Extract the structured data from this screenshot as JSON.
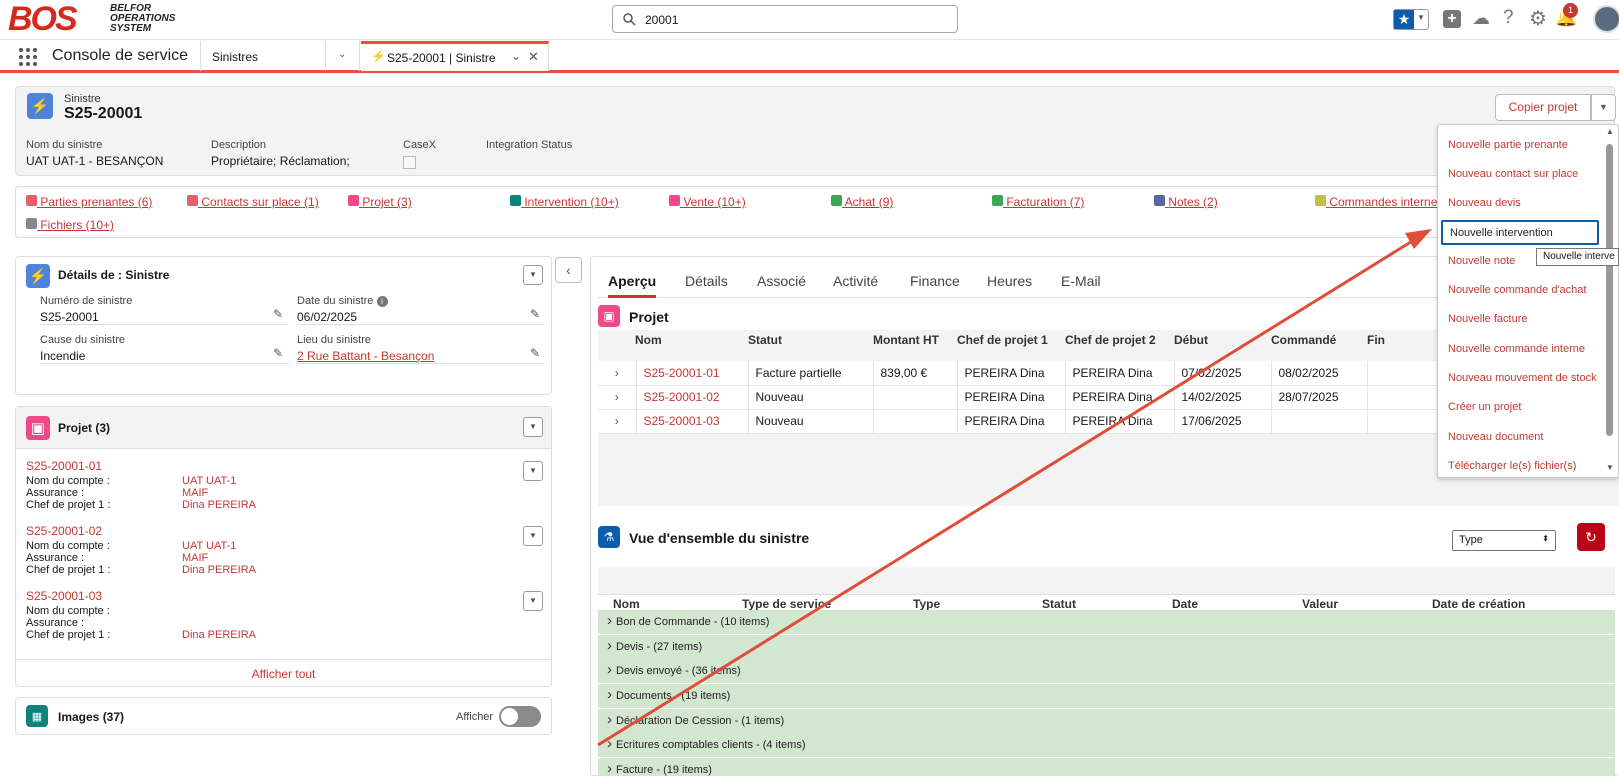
{
  "app": {
    "logo": "BOS",
    "logo_sub": [
      "BELFOR",
      "OPERATIONS",
      "SYSTEM"
    ],
    "app_name": "Console de service",
    "notif_count": "1"
  },
  "search": {
    "value": "20001"
  },
  "nav": {
    "object_tab": "Sinistres",
    "record_tab": "S25-20001 | Sinistre"
  },
  "record": {
    "type": "Sinistre",
    "name": "S25-20001",
    "copy_btn": "Copier projet"
  },
  "highlights": [
    {
      "label": "Nom du sinistre",
      "value": "UAT UAT-1 - BESANÇON"
    },
    {
      "label": "Description",
      "value": "Propriétaire; Réclamation;"
    },
    {
      "label": "CaseX",
      "value": ""
    },
    {
      "label": "Integration Status",
      "value": ""
    }
  ],
  "related": [
    "Parties prenantes (6)",
    "Contacts sur place (1)",
    "Projet (3)",
    "Intervention (10+)",
    "Vente (10+)",
    "Achat (9)",
    "Facturation (7)",
    "Notes (2)",
    "Commandes internes",
    "Fichiers (10+)"
  ],
  "details": {
    "title": "Détails de : Sinistre",
    "f1_label": "Numéro de sinistre",
    "f1_value": "S25-20001",
    "f2_label": "Date du sinistre",
    "f2_value": "06/02/2025",
    "f3_label": "Cause du sinistre",
    "f3_value": "Incendie",
    "f4_label": "Lieu du sinistre",
    "f4_value": "2 Rue Battant - Besançon"
  },
  "projets_card": {
    "title": "Projet (3)",
    "show_all": "Afficher tout",
    "l_account": "Nom du compte :",
    "l_ins": "Assurance :",
    "l_pm": "Chef de projet 1 :",
    "items": [
      {
        "name": "S25-20001-01",
        "account": "UAT UAT-1",
        "ins": "MAIF",
        "pm": "Dina PEREIRA"
      },
      {
        "name": "S25-20001-02",
        "account": "UAT UAT-1",
        "ins": "MAIF",
        "pm": "Dina PEREIRA"
      },
      {
        "name": "S25-20001-03",
        "account": "",
        "ins": "",
        "pm": "Dina PEREIRA"
      }
    ]
  },
  "images": {
    "title": "Images (37)",
    "toggle_label": "Afficher"
  },
  "tabs": [
    "Aperçu",
    "Détails",
    "Associé",
    "Activité",
    "Finance",
    "Heures",
    "E-Mail"
  ],
  "projet_table": {
    "title": "Projet",
    "headers": [
      "Nom",
      "Statut",
      "Montant HT",
      "Chef de projet 1",
      "Chef de projet 2",
      "Début",
      "Commandé",
      "Fin"
    ],
    "rows": [
      [
        "S25-20001-01",
        "Facture partielle",
        "839,00 €",
        "PEREIRA Dina",
        "PEREIRA Dina",
        "07/02/2025",
        "08/02/2025",
        ""
      ],
      [
        "S25-20001-02",
        "Nouveau",
        "",
        "PEREIRA Dina",
        "PEREIRA Dina",
        "14/02/2025",
        "28/07/2025",
        ""
      ],
      [
        "S25-20001-03",
        "Nouveau",
        "",
        "PEREIRA Dina",
        "PEREIRA Dina",
        "17/06/2025",
        "",
        ""
      ]
    ]
  },
  "overview": {
    "title": "Vue d'ensemble du sinistre",
    "type_select": "Type",
    "headers": [
      "Nom",
      "Type de service",
      "Type",
      "Statut",
      "Date",
      "Valeur",
      "Date de création"
    ],
    "groups": [
      "Bon de Commande - (10 items)",
      "Devis - (27 items)",
      "Devis envoyé - (36 items)",
      "Documents - (19 items)",
      "Déclaration De Cession - (1 items)",
      "Ecritures comptables clients - (4 items)",
      "Facture - (19 items)"
    ]
  },
  "menu": {
    "items": [
      "Nouvelle partie prenante",
      "Nouveau contact sur place",
      "Nouveau devis",
      "Nouvelle intervention",
      "Nouvelle note",
      "Nouvelle commande d'achat",
      "Nouvelle facture",
      "Nouvelle commande interne",
      "Nouveau mouvement de stock",
      "Créer un projet",
      "Nouveau document",
      "Télécharger le(s) fichier(s)"
    ],
    "tooltip": "Nouvelle interve"
  },
  "colors": {
    "accent": "#c23934",
    "brand": "#d52b1e",
    "nav_line": "#e8503a",
    "green": "#d3e6cf"
  }
}
